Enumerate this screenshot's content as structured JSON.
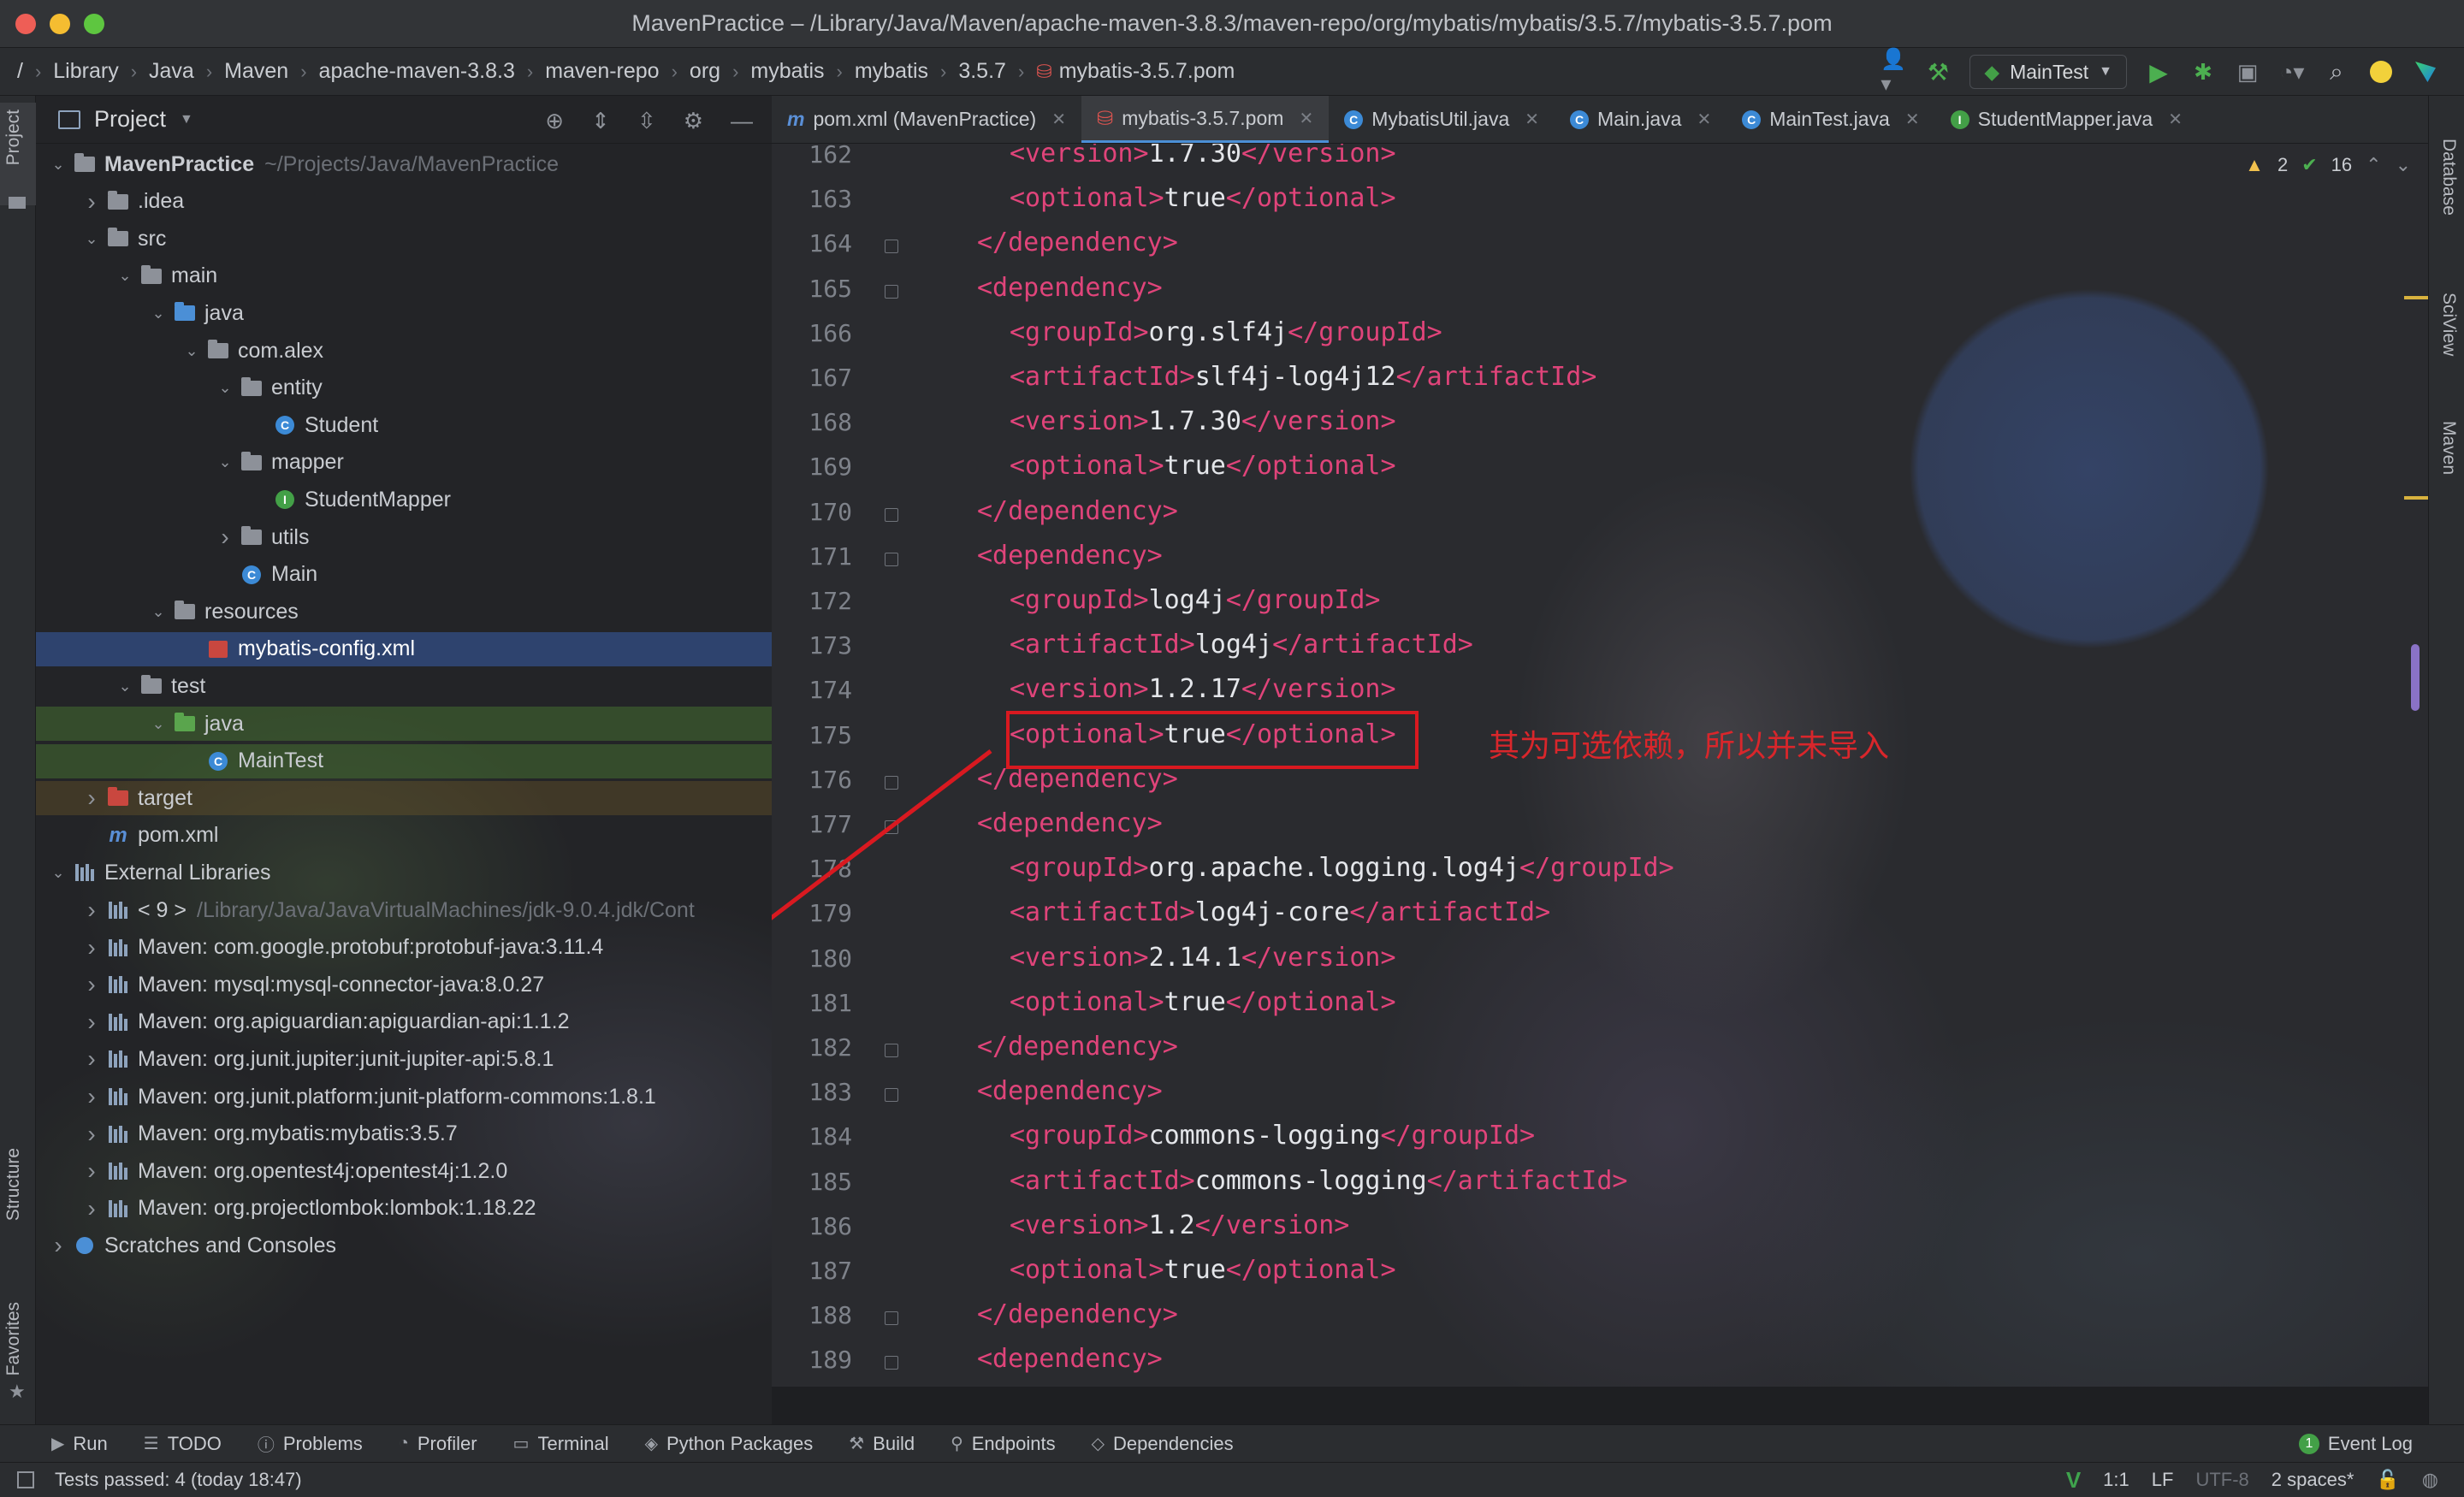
{
  "window": {
    "title": "MavenPractice – /Library/Java/Maven/apache-maven-3.8.3/maven-repo/org/mybatis/mybatis/3.5.7/mybatis-3.5.7.pom",
    "traffic_colors": [
      "#ee5e56",
      "#f5bd31",
      "#5ec640"
    ]
  },
  "breadcrumbs": [
    "/",
    "Library",
    "Java",
    "Maven",
    "apache-maven-3.8.3",
    "maven-repo",
    "org",
    "mybatis",
    "mybatis",
    "3.5.7",
    "mybatis-3.5.7.pom"
  ],
  "run": {
    "config": "MainTest"
  },
  "left_strip": {
    "project": "Project",
    "structure": "Structure",
    "favorites": "Favorites"
  },
  "right_strip": {
    "database": "Database",
    "sciview": "SciView",
    "maven": "Maven"
  },
  "project_panel": {
    "title": "Project",
    "tree": [
      {
        "indent": 0,
        "arrow": "v",
        "icon": "folder",
        "label": "MavenPractice",
        "extra": "~/Projects/Java/MavenPractice",
        "bold": true
      },
      {
        "indent": 1,
        "arrow": ">",
        "icon": "folder",
        "label": ".idea"
      },
      {
        "indent": 1,
        "arrow": "v",
        "icon": "folder",
        "label": "src"
      },
      {
        "indent": 2,
        "arrow": "v",
        "icon": "folder",
        "label": "main"
      },
      {
        "indent": 3,
        "arrow": "v",
        "icon": "folder-blue",
        "label": "java"
      },
      {
        "indent": 4,
        "arrow": "v",
        "icon": "folder",
        "label": "com.alex"
      },
      {
        "indent": 5,
        "arrow": "v",
        "icon": "folder",
        "label": "entity"
      },
      {
        "indent": 6,
        "arrow": "",
        "icon": "class",
        "label": "Student"
      },
      {
        "indent": 5,
        "arrow": "v",
        "icon": "folder",
        "label": "mapper"
      },
      {
        "indent": 6,
        "arrow": "",
        "icon": "interface",
        "label": "StudentMapper"
      },
      {
        "indent": 5,
        "arrow": ">",
        "icon": "folder",
        "label": "utils"
      },
      {
        "indent": 5,
        "arrow": "",
        "icon": "class",
        "label": "Main"
      },
      {
        "indent": 3,
        "arrow": "v",
        "icon": "folder",
        "label": "resources"
      },
      {
        "indent": 4,
        "arrow": "",
        "icon": "xml",
        "label": "mybatis-config.xml",
        "selected": true
      },
      {
        "indent": 2,
        "arrow": "v",
        "icon": "folder",
        "label": "test"
      },
      {
        "indent": 3,
        "arrow": "v",
        "icon": "folder-green",
        "label": "java",
        "test": true
      },
      {
        "indent": 4,
        "arrow": "",
        "icon": "class",
        "label": "MainTest",
        "test": true
      },
      {
        "indent": 1,
        "arrow": ">",
        "icon": "folder-red",
        "label": "target",
        "target": true
      },
      {
        "indent": 1,
        "arrow": "",
        "icon": "maven",
        "label": "pom.xml"
      },
      {
        "indent": 0,
        "arrow": "v",
        "icon": "lib",
        "label": "External Libraries"
      },
      {
        "indent": 1,
        "arrow": ">",
        "icon": "jdk",
        "label": "< 9 >",
        "extra": "/Library/Java/JavaVirtualMachines/jdk-9.0.4.jdk/Cont"
      },
      {
        "indent": 1,
        "arrow": ">",
        "icon": "lib",
        "label": "Maven: com.google.protobuf:protobuf-java:3.11.4"
      },
      {
        "indent": 1,
        "arrow": ">",
        "icon": "lib",
        "label": "Maven: mysql:mysql-connector-java:8.0.27"
      },
      {
        "indent": 1,
        "arrow": ">",
        "icon": "lib",
        "label": "Maven: org.apiguardian:apiguardian-api:1.1.2"
      },
      {
        "indent": 1,
        "arrow": ">",
        "icon": "lib",
        "label": "Maven: org.junit.jupiter:junit-jupiter-api:5.8.1"
      },
      {
        "indent": 1,
        "arrow": ">",
        "icon": "lib",
        "label": "Maven: org.junit.platform:junit-platform-commons:1.8.1"
      },
      {
        "indent": 1,
        "arrow": ">",
        "icon": "lib",
        "label": "Maven: org.mybatis:mybatis:3.5.7"
      },
      {
        "indent": 1,
        "arrow": ">",
        "icon": "lib",
        "label": "Maven: org.opentest4j:opentest4j:1.2.0"
      },
      {
        "indent": 1,
        "arrow": ">",
        "icon": "lib",
        "label": "Maven: org.projectlombok:lombok:1.18.22"
      },
      {
        "indent": 0,
        "arrow": ">",
        "icon": "scratch",
        "label": "Scratches and Consoles"
      }
    ]
  },
  "editor_tabs": [
    {
      "label": "pom.xml (MavenPractice)",
      "icon": "maven"
    },
    {
      "label": "mybatis-3.5.7.pom",
      "icon": "pom",
      "active": true
    },
    {
      "label": "MybatisUtil.java",
      "icon": "class"
    },
    {
      "label": "Main.java",
      "icon": "class"
    },
    {
      "label": "MainTest.java",
      "icon": "class"
    },
    {
      "label": "StudentMapper.java",
      "icon": "interface"
    }
  ],
  "inspections": {
    "warnings": "2",
    "ok": "16"
  },
  "code_lines": [
    {
      "n": "162",
      "indent": 2,
      "parts": [
        [
          "t",
          "<version>"
        ],
        [
          "x",
          "1.7.30"
        ],
        [
          "t",
          "</version>"
        ]
      ]
    },
    {
      "n": "163",
      "indent": 2,
      "parts": [
        [
          "t",
          "<optional>"
        ],
        [
          "x",
          "true"
        ],
        [
          "t",
          "</optional>"
        ]
      ]
    },
    {
      "n": "164",
      "indent": 1,
      "parts": [
        [
          "t",
          "</dependency>"
        ]
      ]
    },
    {
      "n": "165",
      "indent": 1,
      "parts": [
        [
          "t",
          "<dependency>"
        ]
      ]
    },
    {
      "n": "166",
      "indent": 2,
      "parts": [
        [
          "t",
          "<groupId>"
        ],
        [
          "x",
          "org.slf4j"
        ],
        [
          "t",
          "</groupId>"
        ]
      ]
    },
    {
      "n": "167",
      "indent": 2,
      "parts": [
        [
          "t",
          "<artifactId>"
        ],
        [
          "x",
          "slf4j-log4j12"
        ],
        [
          "t",
          "</artifactId>"
        ]
      ]
    },
    {
      "n": "168",
      "indent": 2,
      "parts": [
        [
          "t",
          "<version>"
        ],
        [
          "x",
          "1.7.30"
        ],
        [
          "t",
          "</version>"
        ]
      ]
    },
    {
      "n": "169",
      "indent": 2,
      "parts": [
        [
          "t",
          "<optional>"
        ],
        [
          "x",
          "true"
        ],
        [
          "t",
          "</optional>"
        ]
      ]
    },
    {
      "n": "170",
      "indent": 1,
      "parts": [
        [
          "t",
          "</dependency>"
        ]
      ]
    },
    {
      "n": "171",
      "indent": 1,
      "parts": [
        [
          "t",
          "<dependency>"
        ]
      ]
    },
    {
      "n": "172",
      "indent": 2,
      "parts": [
        [
          "t",
          "<groupId>"
        ],
        [
          "x",
          "log4j"
        ],
        [
          "t",
          "</groupId>"
        ]
      ]
    },
    {
      "n": "173",
      "indent": 2,
      "parts": [
        [
          "t",
          "<artifactId>"
        ],
        [
          "x",
          "log4j"
        ],
        [
          "t",
          "</artifactId>"
        ]
      ]
    },
    {
      "n": "174",
      "indent": 2,
      "parts": [
        [
          "t",
          "<version>"
        ],
        [
          "x",
          "1.2.17"
        ],
        [
          "t",
          "</version>"
        ]
      ]
    },
    {
      "n": "175",
      "indent": 2,
      "parts": [
        [
          "t",
          "<optional>"
        ],
        [
          "x",
          "true"
        ],
        [
          "t",
          "</optional>"
        ]
      ]
    },
    {
      "n": "176",
      "indent": 1,
      "parts": [
        [
          "t",
          "</dependency>"
        ]
      ]
    },
    {
      "n": "177",
      "indent": 1,
      "parts": [
        [
          "t",
          "<dependency>"
        ]
      ]
    },
    {
      "n": "178",
      "indent": 2,
      "parts": [
        [
          "t",
          "<groupId>"
        ],
        [
          "x",
          "org.apache.logging.log4j"
        ],
        [
          "t",
          "</groupId>"
        ]
      ]
    },
    {
      "n": "179",
      "indent": 2,
      "parts": [
        [
          "t",
          "<artifactId>"
        ],
        [
          "x",
          "log4j-core"
        ],
        [
          "t",
          "</artifactId>"
        ]
      ]
    },
    {
      "n": "180",
      "indent": 2,
      "parts": [
        [
          "t",
          "<version>"
        ],
        [
          "x",
          "2.14.1"
        ],
        [
          "t",
          "</version>"
        ]
      ]
    },
    {
      "n": "181",
      "indent": 2,
      "parts": [
        [
          "t",
          "<optional>"
        ],
        [
          "x",
          "true"
        ],
        [
          "t",
          "</optional>"
        ]
      ]
    },
    {
      "n": "182",
      "indent": 1,
      "parts": [
        [
          "t",
          "</dependency>"
        ]
      ]
    },
    {
      "n": "183",
      "indent": 1,
      "parts": [
        [
          "t",
          "<dependency>"
        ]
      ]
    },
    {
      "n": "184",
      "indent": 2,
      "parts": [
        [
          "t",
          "<groupId>"
        ],
        [
          "x",
          "commons-logging"
        ],
        [
          "t",
          "</groupId>"
        ]
      ]
    },
    {
      "n": "185",
      "indent": 2,
      "parts": [
        [
          "t",
          "<artifactId>"
        ],
        [
          "x",
          "commons-logging"
        ],
        [
          "t",
          "</artifactId>"
        ]
      ]
    },
    {
      "n": "186",
      "indent": 2,
      "parts": [
        [
          "t",
          "<version>"
        ],
        [
          "x",
          "1.2"
        ],
        [
          "t",
          "</version>"
        ]
      ]
    },
    {
      "n": "187",
      "indent": 2,
      "parts": [
        [
          "t",
          "<optional>"
        ],
        [
          "x",
          "true"
        ],
        [
          "t",
          "</optional>"
        ]
      ]
    },
    {
      "n": "188",
      "indent": 1,
      "parts": [
        [
          "t",
          "</dependency>"
        ]
      ]
    },
    {
      "n": "189",
      "indent": 1,
      "parts": [
        [
          "t",
          "<dependency>"
        ]
      ]
    }
  ],
  "annotation": {
    "text": "其为可选依赖，所以并未导入",
    "color": "#d9262b"
  },
  "bottom_tools": [
    {
      "label": "Run",
      "icon": "run-icon"
    },
    {
      "label": "TODO",
      "icon": "todo-icon"
    },
    {
      "label": "Problems",
      "icon": "problems-icon"
    },
    {
      "label": "Profiler",
      "icon": "profiler-icon"
    },
    {
      "label": "Terminal",
      "icon": "terminal-icon"
    },
    {
      "label": "Python Packages",
      "icon": "packages-icon"
    },
    {
      "label": "Build",
      "icon": "build-icon"
    },
    {
      "label": "Endpoints",
      "icon": "endpoints-icon"
    },
    {
      "label": "Dependencies",
      "icon": "dependencies-icon"
    }
  ],
  "event_log": {
    "label": "Event Log",
    "count": "1"
  },
  "status": {
    "message": "Tests passed: 4 (today 18:47)",
    "position": "1:1",
    "line_sep": "LF",
    "encoding": "UTF-8",
    "indent": "2 spaces*"
  },
  "colors": {
    "tag": "#e0447a",
    "text": "#e4e6ea",
    "accent": "#4b8fd6",
    "highlight_box": "#d91920"
  }
}
